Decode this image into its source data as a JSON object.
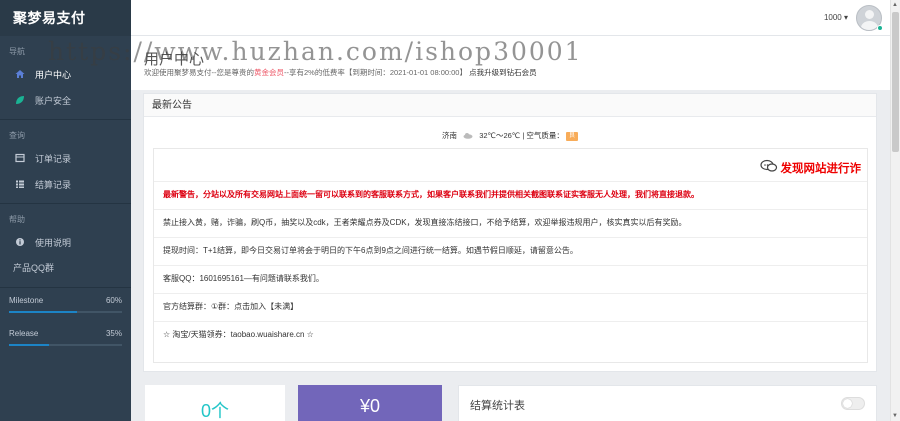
{
  "brand": "聚梦易支付",
  "watermark": "https://www.huzhan.com/ishop30001",
  "sidebar": {
    "sections": [
      {
        "title": "导航",
        "items": [
          {
            "label": "用户中心",
            "icon": "home-icon"
          },
          {
            "label": "账户安全",
            "icon": "leaf-icon"
          }
        ]
      },
      {
        "title": "查询",
        "items": [
          {
            "label": "订单记录",
            "icon": "table-icon"
          },
          {
            "label": "结算记录",
            "icon": "list-icon"
          }
        ]
      },
      {
        "title": "帮助",
        "items": [
          {
            "label": "使用说明",
            "icon": "info-icon"
          }
        ]
      }
    ],
    "qq_group_label": "产品QQ群",
    "progress": [
      {
        "label": "Milestone",
        "value": "60%",
        "fraction": 0.6
      },
      {
        "label": "Release",
        "value": "35%",
        "fraction": 0.35
      }
    ]
  },
  "topbar": {
    "user": "1000",
    "caret": "▾"
  },
  "page": {
    "title": "用户中心",
    "subtitle_pre": "欢迎使用聚梦易支付--您是尊贵的",
    "subtitle_level": "黄金会员",
    "subtitle_mid": "--享有2%的低费率【到期时间：2021-01-01 08:00:00】",
    "subtitle_link": "点我升级到钻石会员"
  },
  "notice": {
    "title": "最新公告",
    "weather": {
      "city": "济南",
      "temp": "32℃～26℃",
      "sep": "|",
      "aqi_label": "空气质量：",
      "aqi": "良"
    },
    "headline": "发现网站进行诈",
    "lines": [
      "最新警告，分站以及所有交易网站上面统一留可以联系到的客服联系方式，如果客户联系我们并提供相关截图联系证实客服无人处理，我们将直接退款。",
      "禁止接入黄，赌，诈骗，刷Q币，抽奖以及cdk，王者荣耀点券及CDK，发现直接冻结接口，不给予结算，欢迎举报违规用户，核实真实以后有奖励。",
      "提现时间：T+1结算，即今日交易订单将会于明日的下午6点到9点之间进行统一结算。如遇节假日顺延，请留意公告。",
      "客服QQ：1601695161—有问题请联系我们。",
      "官方结算群：①群：点击加入【未满】",
      "☆ 淘宝/天猫领券：taobao.wuaishare.cn ☆"
    ]
  },
  "cards": {
    "orders": "0个",
    "amount": "¥0",
    "settle_stats": "结算统计表"
  },
  "colors": {
    "sidebar": "#2f4050",
    "accent_blue": "#1c84c6",
    "cyan": "#23c6c8",
    "purple": "#7266ba",
    "red": "#e00"
  }
}
